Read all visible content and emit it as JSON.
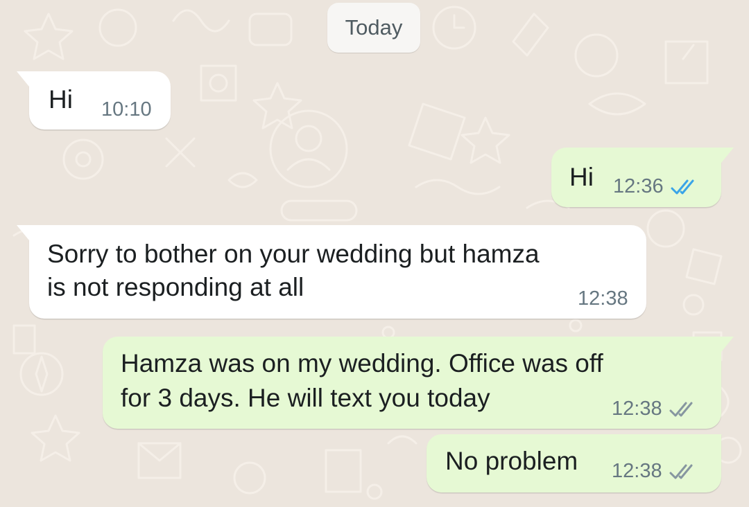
{
  "chat": {
    "date_label": "Today",
    "colors": {
      "background": "#ece5dd",
      "incoming_bubble": "#ffffff",
      "outgoing_bubble": "#e6f9d4",
      "read_ticks": "#3aa4e8",
      "delivered_ticks": "#8696a0"
    },
    "messages": [
      {
        "direction": "incoming",
        "lines": [
          "Hi"
        ],
        "time": "10:10"
      },
      {
        "direction": "outgoing",
        "lines": [
          "Hi"
        ],
        "time": "12:36",
        "status": "read",
        "status_icon": "double-check-blue-icon"
      },
      {
        "direction": "incoming",
        "lines": [
          "Sorry to bother on your wedding but hamza",
          "is not responding at all"
        ],
        "time": "12:38"
      },
      {
        "direction": "outgoing",
        "lines": [
          "Hamza was on my wedding. Office was off",
          "for 3 days. He will text you today"
        ],
        "time": "12:38",
        "status": "delivered",
        "status_icon": "double-check-gray-icon"
      },
      {
        "direction": "outgoing",
        "lines": [
          "No problem"
        ],
        "time": "12:38",
        "status": "delivered",
        "status_icon": "double-check-gray-icon"
      }
    ]
  }
}
